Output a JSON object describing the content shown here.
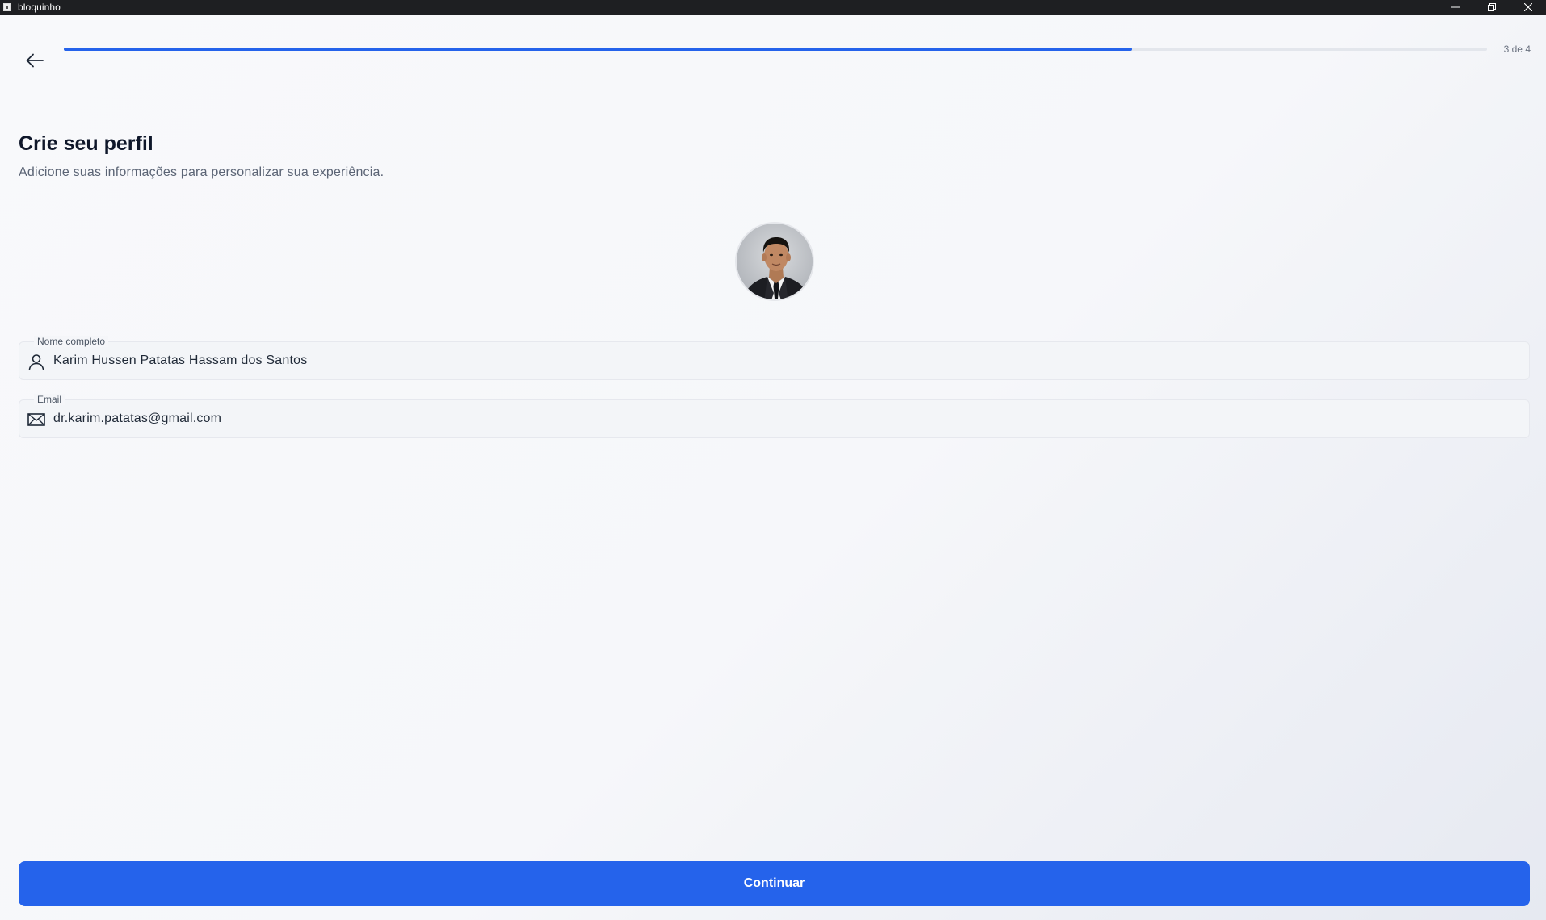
{
  "window": {
    "title": "bloquinho",
    "controls": [
      "minimize-icon",
      "restore-icon",
      "close-icon"
    ]
  },
  "header": {
    "back_icon": "arrow-left-icon",
    "progress": {
      "current": 3,
      "total": 4,
      "fraction": 0.75
    },
    "step_label": "3 de 4"
  },
  "profile": {
    "title": "Crie seu perfil",
    "subtitle": "Adicione suas informações para personalizar sua experiência.",
    "avatar": "profile-photo"
  },
  "form": {
    "name": {
      "label": "Nome completo",
      "value": "Karim Hussen Patatas Hassam dos Santos",
      "icon": "user-icon"
    },
    "email": {
      "label": "Email",
      "value": "dr.karim.patatas@gmail.com",
      "icon": "mail-icon"
    }
  },
  "actions": {
    "continue_label": "Continuar"
  },
  "colors": {
    "accent": "#2563eb",
    "titlebar": "#1e1f22",
    "text_primary": "#0f172a",
    "text_secondary": "#5b6475"
  }
}
